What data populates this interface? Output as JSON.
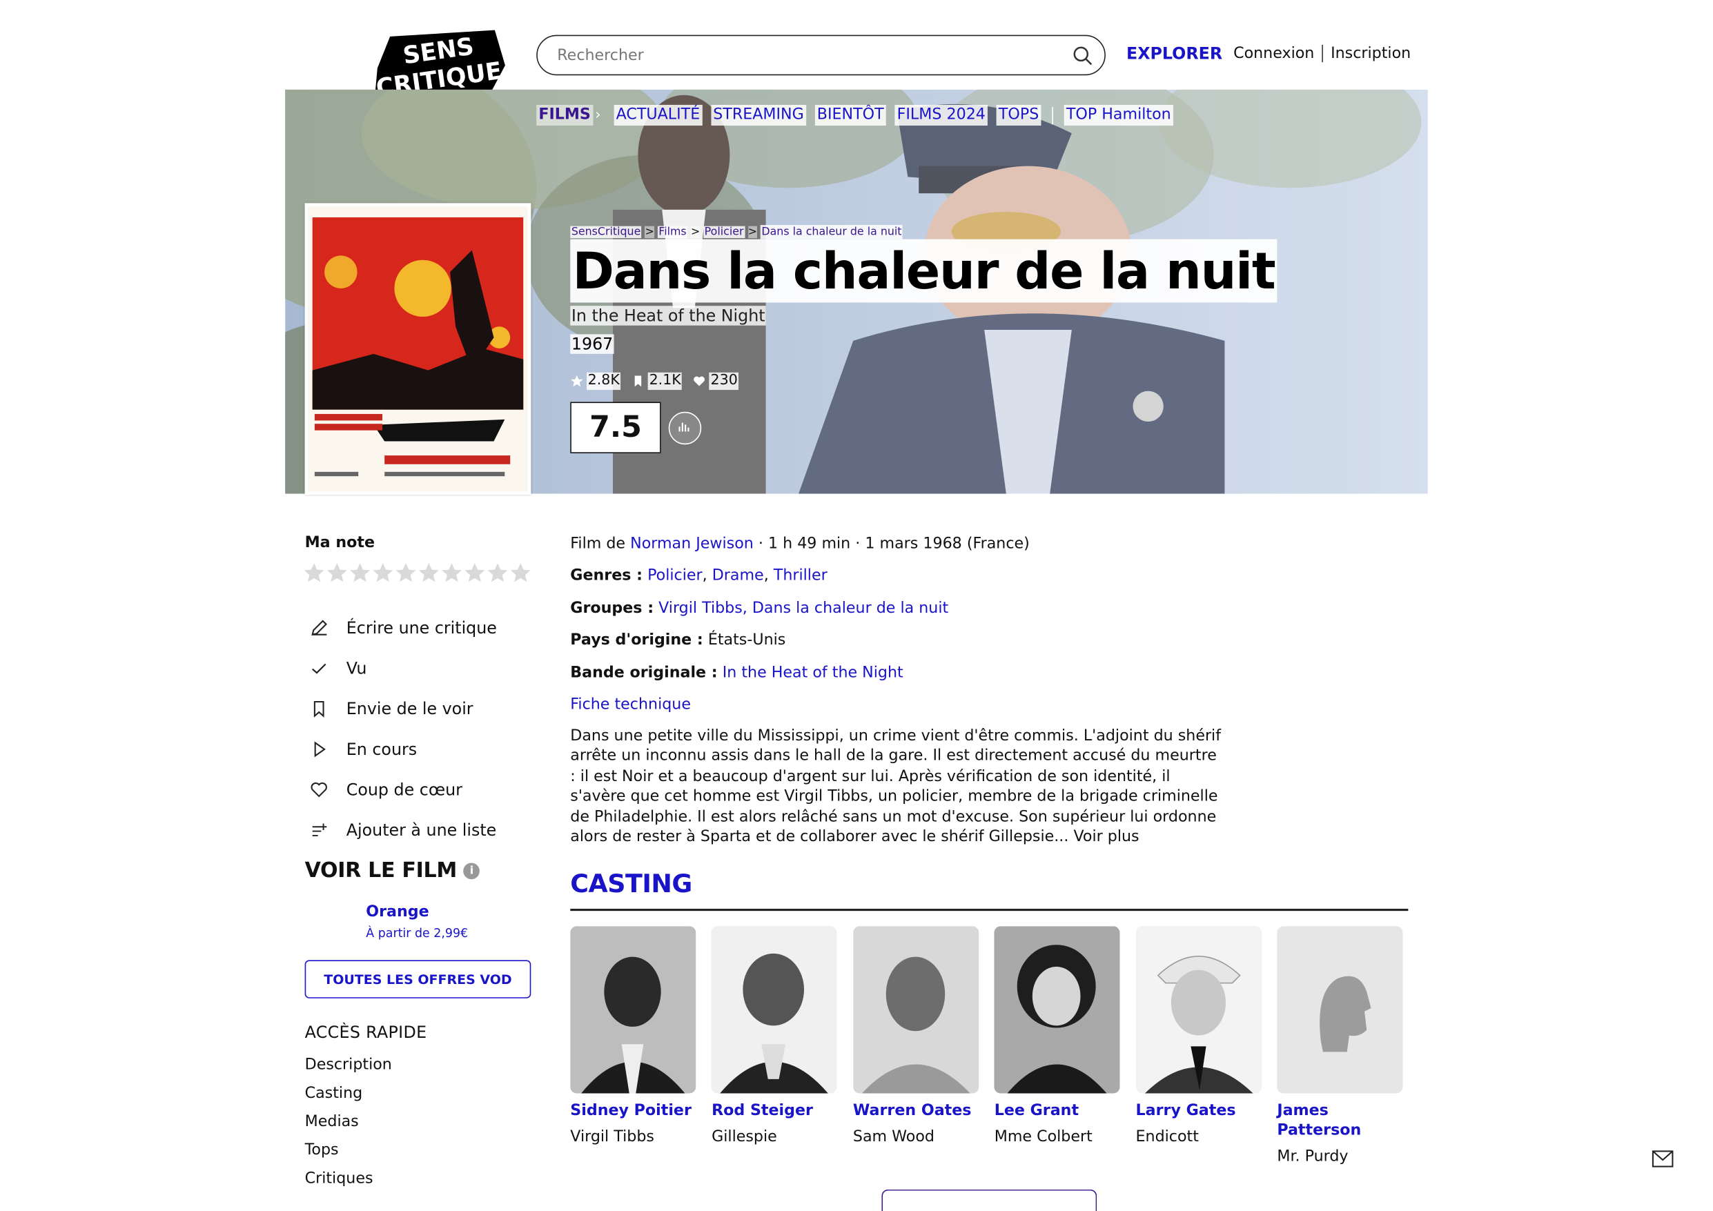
{
  "header": {
    "logo_lines": [
      "SENS",
      "CRITIQUE"
    ],
    "search_placeholder": "Rechercher",
    "explorer": "EXPLORER",
    "login": "Connexion",
    "signup": "Inscription",
    "accent": "#1a14c8"
  },
  "nav": {
    "films": "FILMS",
    "items": [
      "ACTUALITÉ",
      "STREAMING",
      "BIENTÔT",
      "FILMS 2024",
      "TOPS"
    ],
    "top": "TOP Hamilton"
  },
  "breadcrumb": [
    "SensCritique",
    "Films",
    "Policier",
    "Dans la chaleur de la nuit"
  ],
  "breadcrumb_sep": ">",
  "film": {
    "title": "Dans la chaleur de la nuit",
    "original_title": "In the Heat of the Night",
    "year": "1967",
    "stats": {
      "ratings": "2.8K",
      "wishes": "2.1K",
      "favorites": "230"
    },
    "score": "7.5"
  },
  "sidebar": {
    "my_rating": "Ma note",
    "star_count": 10,
    "actions": [
      {
        "icon": "pencil-icon",
        "label": "Écrire une critique"
      },
      {
        "icon": "check-icon",
        "label": "Vu"
      },
      {
        "icon": "bookmark-icon",
        "label": "Envie de le voir"
      },
      {
        "icon": "play-icon",
        "label": "En cours"
      },
      {
        "icon": "heart-icon",
        "label": "Coup de cœur"
      },
      {
        "icon": "list-add-icon",
        "label": "Ajouter à une liste"
      }
    ],
    "watch_title": "VOIR LE FILM",
    "provider": "Orange",
    "provider_price": "À partir de 2,99€",
    "vod_button": "TOUTES LES OFFRES VOD",
    "quick_access_title": "ACCÈS RAPIDE",
    "quick_access": [
      "Description",
      "Casting",
      "Medias",
      "Tops",
      "Critiques"
    ]
  },
  "details": {
    "film_by_label": "Film de",
    "director": "Norman Jewison",
    "runtime_release": "· 1 h 49 min · 1 mars 1968 (France)",
    "genres_label": "Genres :",
    "genres": [
      "Policier",
      "Drame",
      "Thriller"
    ],
    "groups_label": "Groupes :",
    "groups": "Virgil Tibbs, Dans la chaleur de la nuit",
    "country_label": "Pays d'origine :",
    "country": "États-Unis",
    "soundtrack_label": "Bande originale :",
    "soundtrack": "In the Heat of the Night",
    "tech_sheet": "Fiche technique",
    "synopsis": "Dans une petite ville du Mississippi, un crime vient d'être commis. L'adjoint du shérif arrête un inconnu assis dans le hall de la gare. Il est directement accusé du meurtre : il est Noir et a beaucoup d'argent sur lui. Après vérification de son identité, il s'avère que cet homme est Virgil Tibbs, un policier, membre de la brigade criminelle de Philadelphie. Il est alors relâché sans un mot d'excuse. Son supérieur lui ordonne alors de rester à Sparta et de collaborer avec le shérif Gillepsie...",
    "see_more": "Voir plus"
  },
  "casting": {
    "title": "CASTING",
    "actors": [
      {
        "name": "Sidney Poitier",
        "role": "Virgil Tibbs"
      },
      {
        "name": "Rod Steiger",
        "role": "Gillespie"
      },
      {
        "name": "Warren Oates",
        "role": "Sam Wood"
      },
      {
        "name": "Lee Grant",
        "role": "Mme Colbert"
      },
      {
        "name": "Larry Gates",
        "role": "Endicott"
      },
      {
        "name": "James Patterson",
        "role": "Mr. Purdy"
      }
    ]
  }
}
